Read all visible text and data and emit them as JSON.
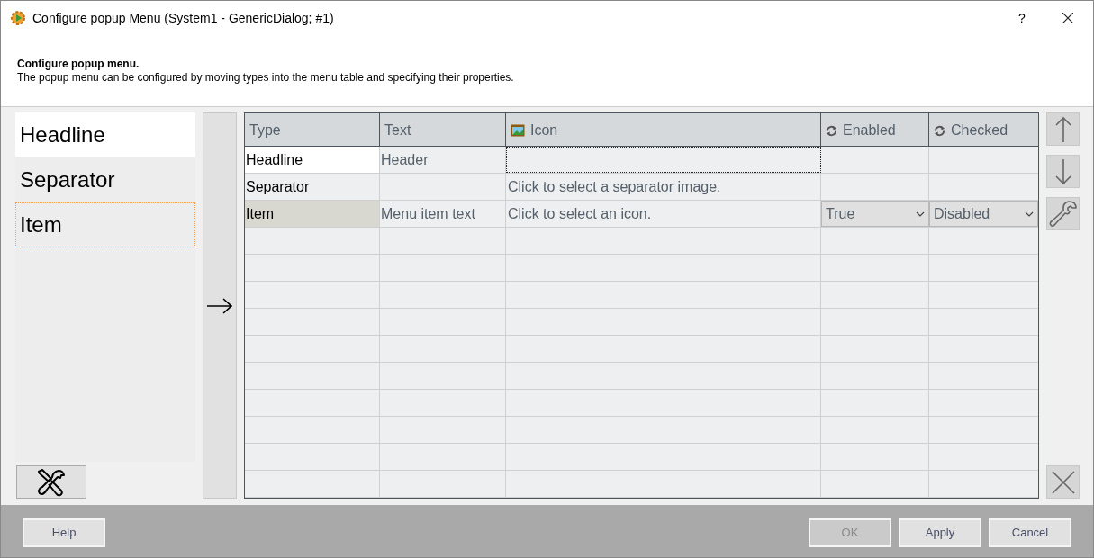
{
  "window": {
    "title": "Configure popup Menu (System1 - GenericDialog; #1)",
    "help": "?"
  },
  "header": {
    "heading": "Configure popup menu.",
    "description": "The popup menu can be configured by moving types into the menu table and specifying their properties."
  },
  "types": [
    {
      "label": "Headline",
      "selected": true,
      "focused": false
    },
    {
      "label": "Separator",
      "selected": false,
      "focused": false
    },
    {
      "label": "Item",
      "selected": false,
      "focused": true
    }
  ],
  "table": {
    "columns": [
      "Type",
      "Text",
      "Icon",
      "Enabled",
      "Checked"
    ],
    "rows": [
      {
        "type": "Headline",
        "text": "Header",
        "selected": true,
        "marked": false
      },
      {
        "type": "Separator",
        "icon": "Click to select a separator image.",
        "selected": false,
        "marked": false
      },
      {
        "type": "Item",
        "text": "Menu item text",
        "icon": "Click to select an icon.",
        "enabled": "True",
        "checked": "Disabled",
        "selected": false,
        "marked": true
      }
    ]
  },
  "buttons": [
    {
      "label": "Help",
      "disabled": false
    },
    {
      "label": "OK",
      "disabled": true
    },
    {
      "label": "Apply",
      "disabled": false
    },
    {
      "label": "Cancel",
      "disabled": false
    }
  ]
}
